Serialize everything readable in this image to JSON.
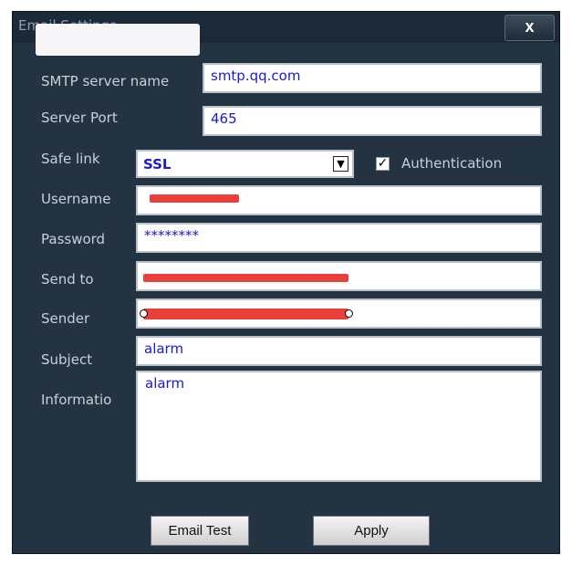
{
  "window": {
    "title": "Email Settings",
    "close_label": "x"
  },
  "fields": {
    "smtp_server": {
      "label": "SMTP server name",
      "value": "smtp.qq.com"
    },
    "server_port": {
      "label": "Server Port",
      "value": "465"
    },
    "safe_link": {
      "label": "Safe link",
      "value": "SSL"
    },
    "authentication": {
      "label": "Authentication",
      "checked": true
    },
    "username": {
      "label": "Username",
      "value": ""
    },
    "password": {
      "label": "Password",
      "value": "********"
    },
    "send_to": {
      "label": "Send to",
      "value": ""
    },
    "sender": {
      "label": "Sender",
      "value": ""
    },
    "subject": {
      "label": "Subject",
      "value": "alarm"
    },
    "information": {
      "label": "Informatio",
      "value": "alarm"
    }
  },
  "buttons": {
    "email_test": "Email Test",
    "apply": "Apply"
  },
  "colors": {
    "background": "#233342",
    "field_text": "#1a1acc",
    "redaction": "#e8413b"
  },
  "icons": {
    "dropdown": "triangle-down-icon",
    "check": "checkmark-icon",
    "close": "close-icon"
  }
}
